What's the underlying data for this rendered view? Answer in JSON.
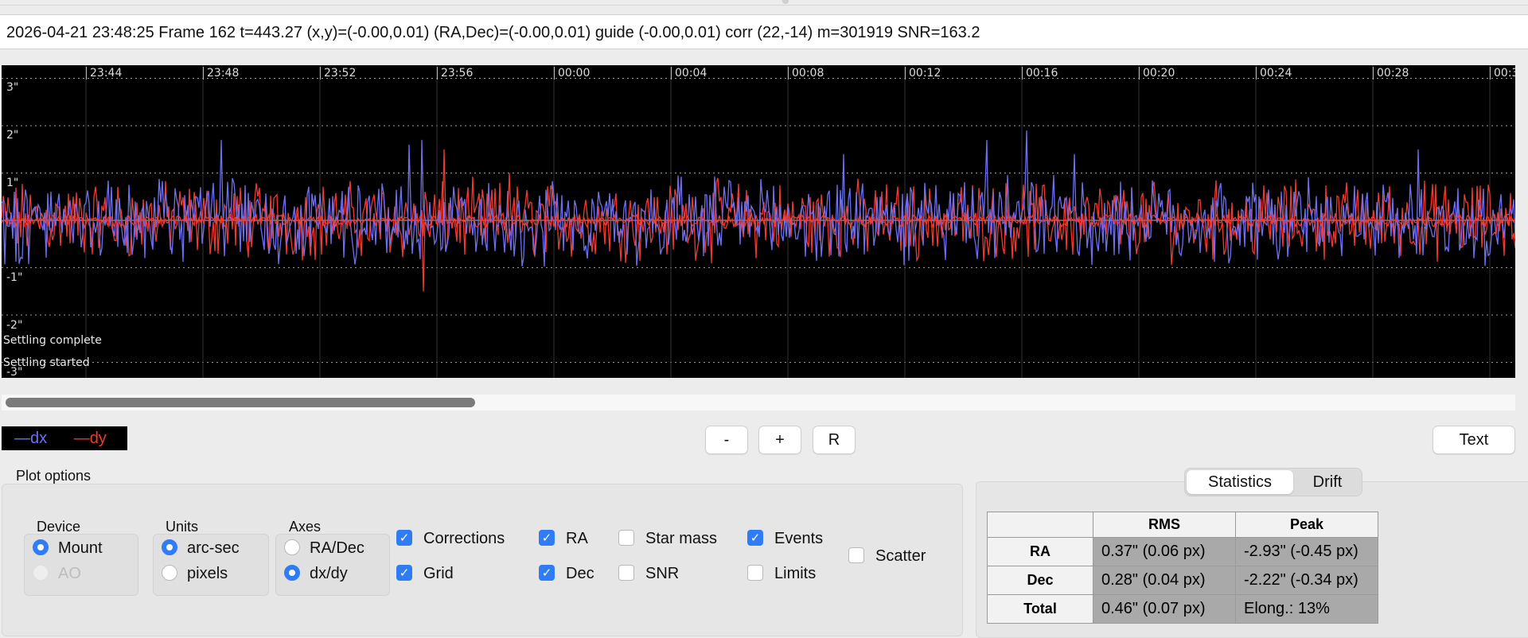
{
  "status_line": "2026-04-21 23:48:25 Frame 162 t=443.27 (x,y)=(-0.00,0.01) (RA,Dec)=(-0.00,0.01) guide (-0.00,0.01) corr (22,-14) m=301919 SNR=163.2",
  "graph": {
    "y_labels": [
      "3\"",
      "2\"",
      "1\"",
      "-1\"",
      "-2\"",
      "-3\""
    ],
    "time_labels": [
      "23:44",
      "23:48",
      "23:52",
      "23:56",
      "00:00",
      "00:04",
      "00:08",
      "00:12",
      "00:16",
      "00:20",
      "00:24",
      "00:28",
      "00:3"
    ],
    "events": {
      "settling_complete": "Settling complete",
      "settling_started": "Settling started"
    },
    "colors": {
      "dx": "#6f6ff2",
      "dy": "#ef3a30",
      "background": "#000000",
      "grid": "#9a9a9a"
    }
  },
  "legend": {
    "dx": "—dx",
    "dy": "—dy"
  },
  "buttons": {
    "minus": "-",
    "plus": "+",
    "reset": "R",
    "text": "Text"
  },
  "plot_options": {
    "title": "Plot options",
    "device": {
      "label": "Device",
      "mount": "Mount",
      "ao": "AO",
      "selected": "Mount"
    },
    "units": {
      "label": "Units",
      "arcsec": "arc-sec",
      "pixels": "pixels",
      "selected": "arc-sec"
    },
    "axes": {
      "label": "Axes",
      "radec": "RA/Dec",
      "dxdy": "dx/dy",
      "selected": "dx/dy"
    },
    "checkboxes": {
      "corrections": "Corrections",
      "grid": "Grid",
      "ra": "RA",
      "dec": "Dec",
      "star_mass": "Star mass",
      "snr": "SNR",
      "events": "Events",
      "limits": "Limits",
      "scatter": "Scatter"
    }
  },
  "stats_tabs": {
    "statistics": "Statistics",
    "drift": "Drift",
    "active": "Statistics"
  },
  "stats_table": {
    "headers": {
      "rms": "RMS",
      "peak": "Peak"
    },
    "rows": [
      {
        "label": "RA",
        "rms": "0.37\" (0.06 px)",
        "peak": "-2.93\" (-0.45 px)"
      },
      {
        "label": "Dec",
        "rms": "0.28\" (0.04 px)",
        "peak": "-2.22\" (-0.34 px)"
      },
      {
        "label": "Total",
        "rms": "0.46\" (0.07 px)",
        "peak": "Elong.: 13%"
      }
    ]
  }
}
